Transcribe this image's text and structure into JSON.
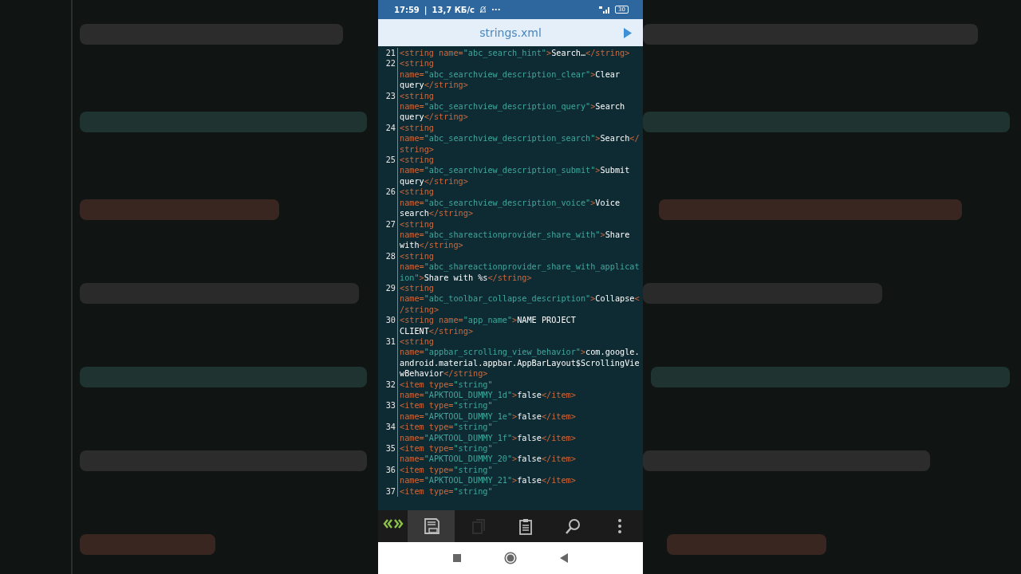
{
  "status_bar": {
    "time": "17:59",
    "divider": "|",
    "speed": "13,7 КБ/с",
    "more": "···",
    "battery": "30"
  },
  "title_bar": {
    "title": "strings.xml"
  },
  "code": [
    {
      "number": "21",
      "tokens": [
        {
          "kind": "tag",
          "text": "<string name="
        },
        {
          "kind": "value",
          "text": "\"abc_search_hint\""
        },
        {
          "kind": "tag",
          "text": ">"
        },
        {
          "kind": "text",
          "text": "Search…"
        },
        {
          "kind": "tag",
          "text": "</string>"
        }
      ]
    },
    {
      "number": "22",
      "tokens": [
        {
          "kind": "tag",
          "text": "<string name="
        },
        {
          "kind": "value",
          "text": "\"abc_searchview_description_clear\""
        },
        {
          "kind": "tag",
          "text": ">"
        },
        {
          "kind": "text",
          "text": "Clear query"
        },
        {
          "kind": "tag",
          "text": "</string>"
        }
      ]
    },
    {
      "number": "23",
      "tokens": [
        {
          "kind": "tag",
          "text": "<string name="
        },
        {
          "kind": "value",
          "text": "\"abc_searchview_description_query\""
        },
        {
          "kind": "tag",
          "text": ">"
        },
        {
          "kind": "text",
          "text": "Search query"
        },
        {
          "kind": "tag",
          "text": "</string>"
        }
      ]
    },
    {
      "number": "24",
      "tokens": [
        {
          "kind": "tag",
          "text": "<string name="
        },
        {
          "kind": "value",
          "text": "\"abc_searchview_description_search\""
        },
        {
          "kind": "tag",
          "text": ">"
        },
        {
          "kind": "text",
          "text": "Search"
        },
        {
          "kind": "tag",
          "text": "</string>"
        }
      ]
    },
    {
      "number": "25",
      "tokens": [
        {
          "kind": "tag",
          "text": "<string name="
        },
        {
          "kind": "value",
          "text": "\"abc_searchview_description_submit\""
        },
        {
          "kind": "tag",
          "text": ">"
        },
        {
          "kind": "text",
          "text": "Submit query"
        },
        {
          "kind": "tag",
          "text": "</string>"
        }
      ]
    },
    {
      "number": "26",
      "tokens": [
        {
          "kind": "tag",
          "text": "<string name="
        },
        {
          "kind": "value",
          "text": "\"abc_searchview_description_voice\""
        },
        {
          "kind": "tag",
          "text": ">"
        },
        {
          "kind": "text",
          "text": "Voice search"
        },
        {
          "kind": "tag",
          "text": "</string>"
        }
      ]
    },
    {
      "number": "27",
      "tokens": [
        {
          "kind": "tag",
          "text": "<string name="
        },
        {
          "kind": "value",
          "text": "\"abc_shareactionprovider_share_with\""
        },
        {
          "kind": "tag",
          "text": ">"
        },
        {
          "kind": "text",
          "text": "Share with"
        },
        {
          "kind": "tag",
          "text": "</string>"
        }
      ]
    },
    {
      "number": "28",
      "tokens": [
        {
          "kind": "tag",
          "text": "<string name="
        },
        {
          "kind": "value",
          "text": "\"abc_shareactionprovider_share_with_application\""
        },
        {
          "kind": "tag",
          "text": ">"
        },
        {
          "kind": "text",
          "text": "Share with %s"
        },
        {
          "kind": "tag",
          "text": "</string>"
        }
      ]
    },
    {
      "number": "29",
      "tokens": [
        {
          "kind": "tag",
          "text": "<string name="
        },
        {
          "kind": "value",
          "text": "\"abc_toolbar_collapse_description\""
        },
        {
          "kind": "tag",
          "text": ">"
        },
        {
          "kind": "text",
          "text": "Collapse"
        },
        {
          "kind": "tag",
          "text": "</string>"
        }
      ]
    },
    {
      "number": "30",
      "tokens": [
        {
          "kind": "tag",
          "text": "<string name="
        },
        {
          "kind": "value",
          "text": "\"app_name\""
        },
        {
          "kind": "tag",
          "text": ">"
        },
        {
          "kind": "text",
          "text": "NAME PROJECT CLIENT"
        },
        {
          "kind": "tag",
          "text": "</string>"
        }
      ]
    },
    {
      "number": "31",
      "tokens": [
        {
          "kind": "tag",
          "text": "<string name="
        },
        {
          "kind": "value",
          "text": "\"appbar_scrolling_view_behavior\""
        },
        {
          "kind": "tag",
          "text": ">"
        },
        {
          "kind": "text",
          "text": "com.google.android.material.appbar.AppBarLayout$ScrollingViewBehavior"
        },
        {
          "kind": "tag",
          "text": "</string>"
        }
      ]
    },
    {
      "number": "32",
      "tokens": [
        {
          "kind": "tag",
          "text": "<item type="
        },
        {
          "kind": "value",
          "text": "\"string\""
        },
        {
          "kind": "tag",
          "text": " name="
        },
        {
          "kind": "value",
          "text": "\"APKTOOL_DUMMY_1d\""
        },
        {
          "kind": "tag",
          "text": ">"
        },
        {
          "kind": "text",
          "text": "false"
        },
        {
          "kind": "tag",
          "text": "</item>"
        }
      ]
    },
    {
      "number": "33",
      "tokens": [
        {
          "kind": "tag",
          "text": "<item type="
        },
        {
          "kind": "value",
          "text": "\"string\""
        },
        {
          "kind": "tag",
          "text": " name="
        },
        {
          "kind": "value",
          "text": "\"APKTOOL_DUMMY_1e\""
        },
        {
          "kind": "tag",
          "text": ">"
        },
        {
          "kind": "text",
          "text": "false"
        },
        {
          "kind": "tag",
          "text": "</item>"
        }
      ]
    },
    {
      "number": "34",
      "tokens": [
        {
          "kind": "tag",
          "text": "<item type="
        },
        {
          "kind": "value",
          "text": "\"string\""
        },
        {
          "kind": "tag",
          "text": " name="
        },
        {
          "kind": "value",
          "text": "\"APKTOOL_DUMMY_1f\""
        },
        {
          "kind": "tag",
          "text": ">"
        },
        {
          "kind": "text",
          "text": "false"
        },
        {
          "kind": "tag",
          "text": "</item>"
        }
      ]
    },
    {
      "number": "35",
      "tokens": [
        {
          "kind": "tag",
          "text": "<item type="
        },
        {
          "kind": "value",
          "text": "\"string\""
        },
        {
          "kind": "tag",
          "text": " name="
        },
        {
          "kind": "value",
          "text": "\"APKTOOL_DUMMY_20\""
        },
        {
          "kind": "tag",
          "text": ">"
        },
        {
          "kind": "text",
          "text": "false"
        },
        {
          "kind": "tag",
          "text": "</item>"
        }
      ]
    },
    {
      "number": "36",
      "tokens": [
        {
          "kind": "tag",
          "text": "<item type="
        },
        {
          "kind": "value",
          "text": "\"string\""
        },
        {
          "kind": "tag",
          "text": " name="
        },
        {
          "kind": "value",
          "text": "\"APKTOOL_DUMMY_21\""
        },
        {
          "kind": "tag",
          "text": ">"
        },
        {
          "kind": "text",
          "text": "false"
        },
        {
          "kind": "tag",
          "text": "</item>"
        }
      ]
    },
    {
      "number": "37",
      "tokens": [
        {
          "kind": "tag",
          "text": "<item type="
        },
        {
          "kind": "value",
          "text": "\"string\""
        }
      ]
    }
  ],
  "toolbar": [
    {
      "kind": "switch",
      "selected": false,
      "disabled": false
    },
    {
      "kind": "save",
      "selected": true,
      "disabled": false
    },
    {
      "kind": "copy",
      "selected": false,
      "disabled": true
    },
    {
      "kind": "paste",
      "selected": false,
      "disabled": false
    },
    {
      "kind": "search",
      "selected": false,
      "disabled": false
    },
    {
      "kind": "more",
      "selected": false,
      "disabled": false
    }
  ]
}
